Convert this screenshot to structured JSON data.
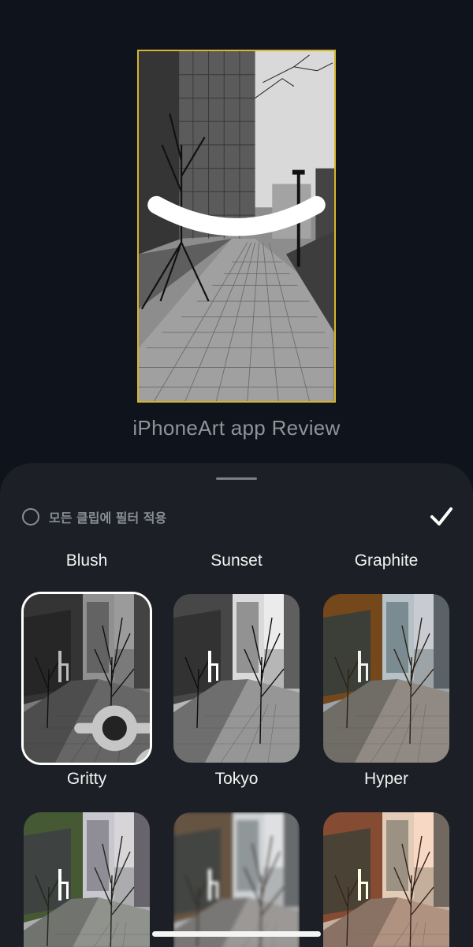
{
  "preview": {
    "title": "iPhoneArt app Review",
    "collapse_icon": "chevron-down-icon"
  },
  "sheet": {
    "apply_all_label": "모든 클립에 필터 적용",
    "confirm_icon": "checkmark-icon",
    "filters": [
      {
        "name": "Blush",
        "label_position": "above",
        "style": "sepia-gold"
      },
      {
        "name": "Sunset",
        "label_position": "above",
        "style": "black-white"
      },
      {
        "name": "Graphite",
        "label_position": "above",
        "style": "vivid"
      },
      {
        "name": "Gritty",
        "label_position": "below",
        "style": "grayscale",
        "selected": true,
        "adjust_icon": "sliders-icon"
      },
      {
        "name": "Tokyo",
        "label_position": "below",
        "style": "black-white"
      },
      {
        "name": "Hyper",
        "label_position": "below",
        "style": "vivid"
      },
      {
        "name": "",
        "style": "green-tint"
      },
      {
        "name": "",
        "style": "soft-blur"
      },
      {
        "name": "",
        "style": "red-tint"
      }
    ]
  },
  "colors": {
    "background": "#0f141c",
    "sheet": "#1c1f25",
    "selection_border": "#d8b52a",
    "selected_thumb_ring": "#ffffff"
  }
}
